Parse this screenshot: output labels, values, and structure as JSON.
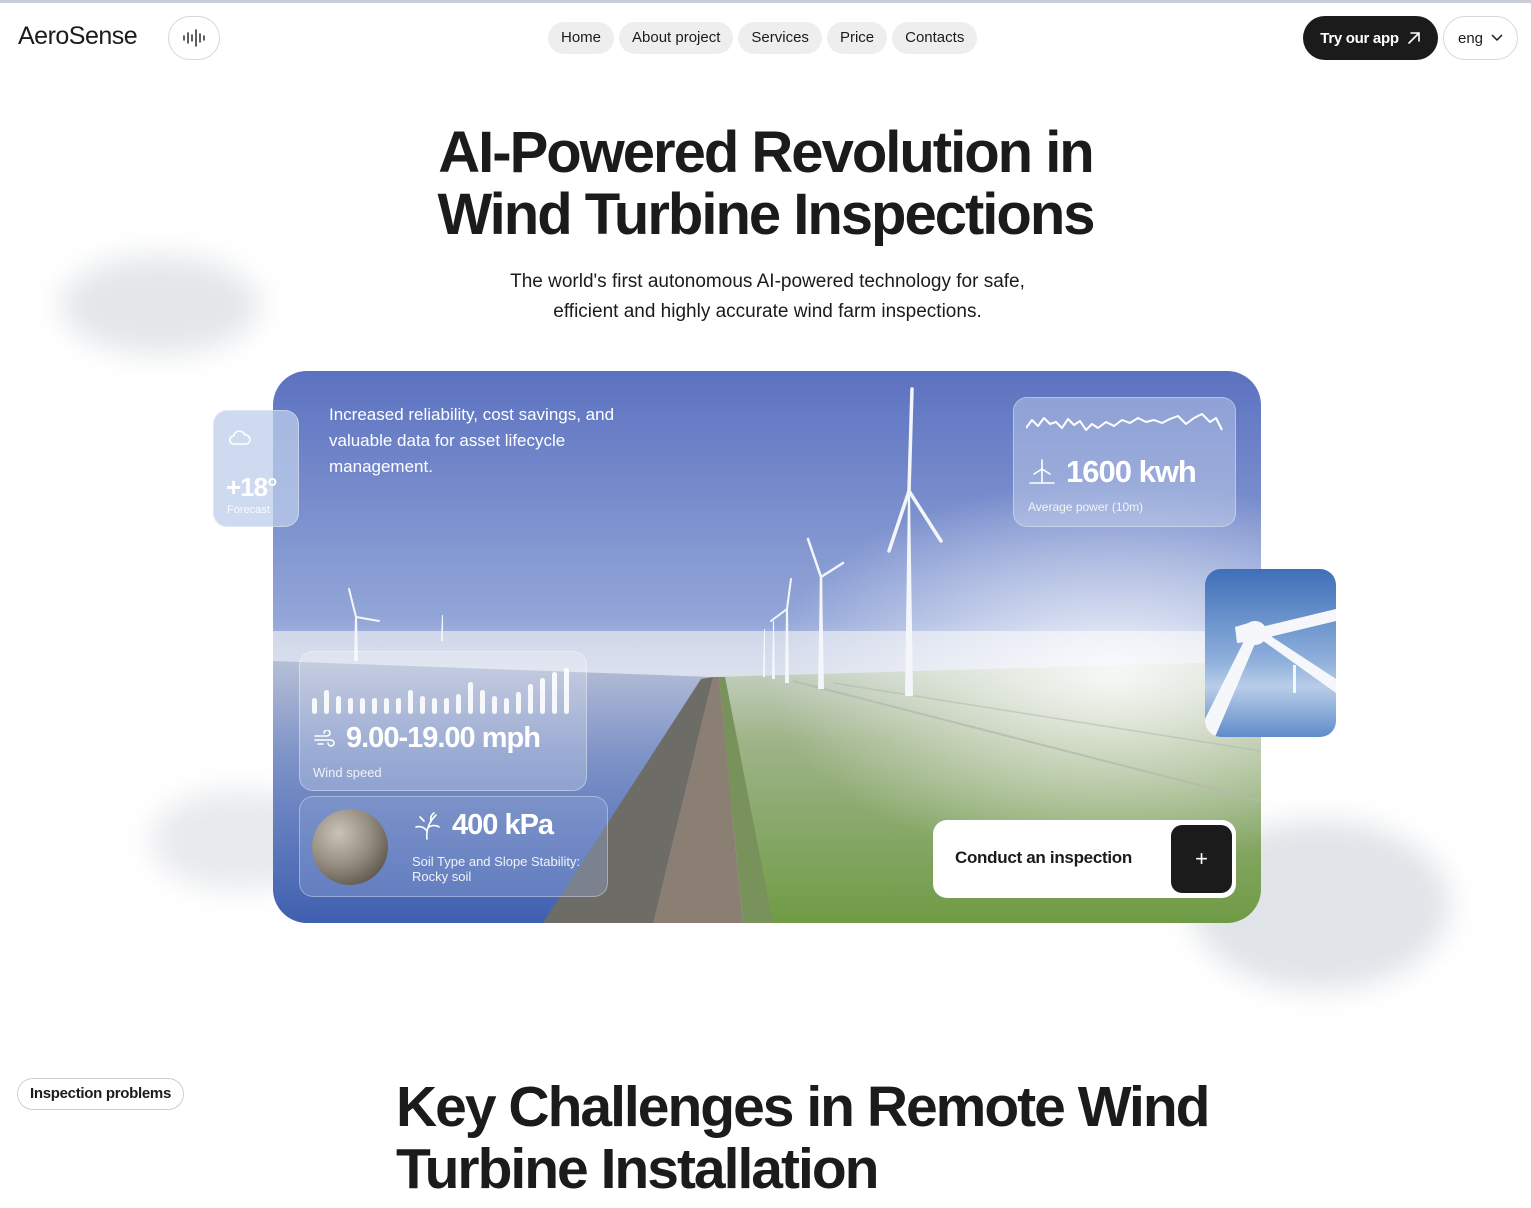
{
  "header": {
    "logo": "AeroSense",
    "nav": [
      "Home",
      "About project",
      "Services",
      "Price",
      "Contacts"
    ],
    "cta_label": "Try our app",
    "language": "eng"
  },
  "hero": {
    "title_line1": "AI-Powered Revolution in",
    "title_line2": "Wind Turbine Inspections",
    "subtitle_line1": "The world's first autonomous AI-powered technology for safe,",
    "subtitle_line2": "efficient and highly accurate wind farm inspections."
  },
  "photo_card": {
    "tagline": "Increased reliability, cost savings, and valuable data for asset lifecycle management.",
    "forecast": {
      "value": "+18°",
      "label": "Forecast"
    },
    "power": {
      "value": "1600 kwh",
      "label": "Average power (10m)"
    },
    "wind": {
      "value": "9.00-19.00 mph",
      "label": "Wind speed"
    },
    "soil": {
      "value": "400 kPa",
      "label": "Soil Type and Slope Stability: Rocky soil"
    },
    "inspect_label": "Conduct an inspection",
    "inspect_icon": "+"
  },
  "section2": {
    "badge": "Inspection problems",
    "title_line1": "Key Challenges in Remote Wind",
    "title_line2": "Turbine Installation"
  },
  "icons": {
    "voice": "waveform-icon",
    "cta": "arrow-up-right-icon",
    "language": "chevron-down-icon",
    "forecast": "cloud-icon",
    "power": "turbine-icon",
    "wind": "wind-icon",
    "soil": "plant-icon"
  },
  "colors": {
    "dark": "#1b1b1b",
    "sky_top": "#5f78c4",
    "grass": "#7aa24e",
    "water": "#4f6fb8"
  }
}
